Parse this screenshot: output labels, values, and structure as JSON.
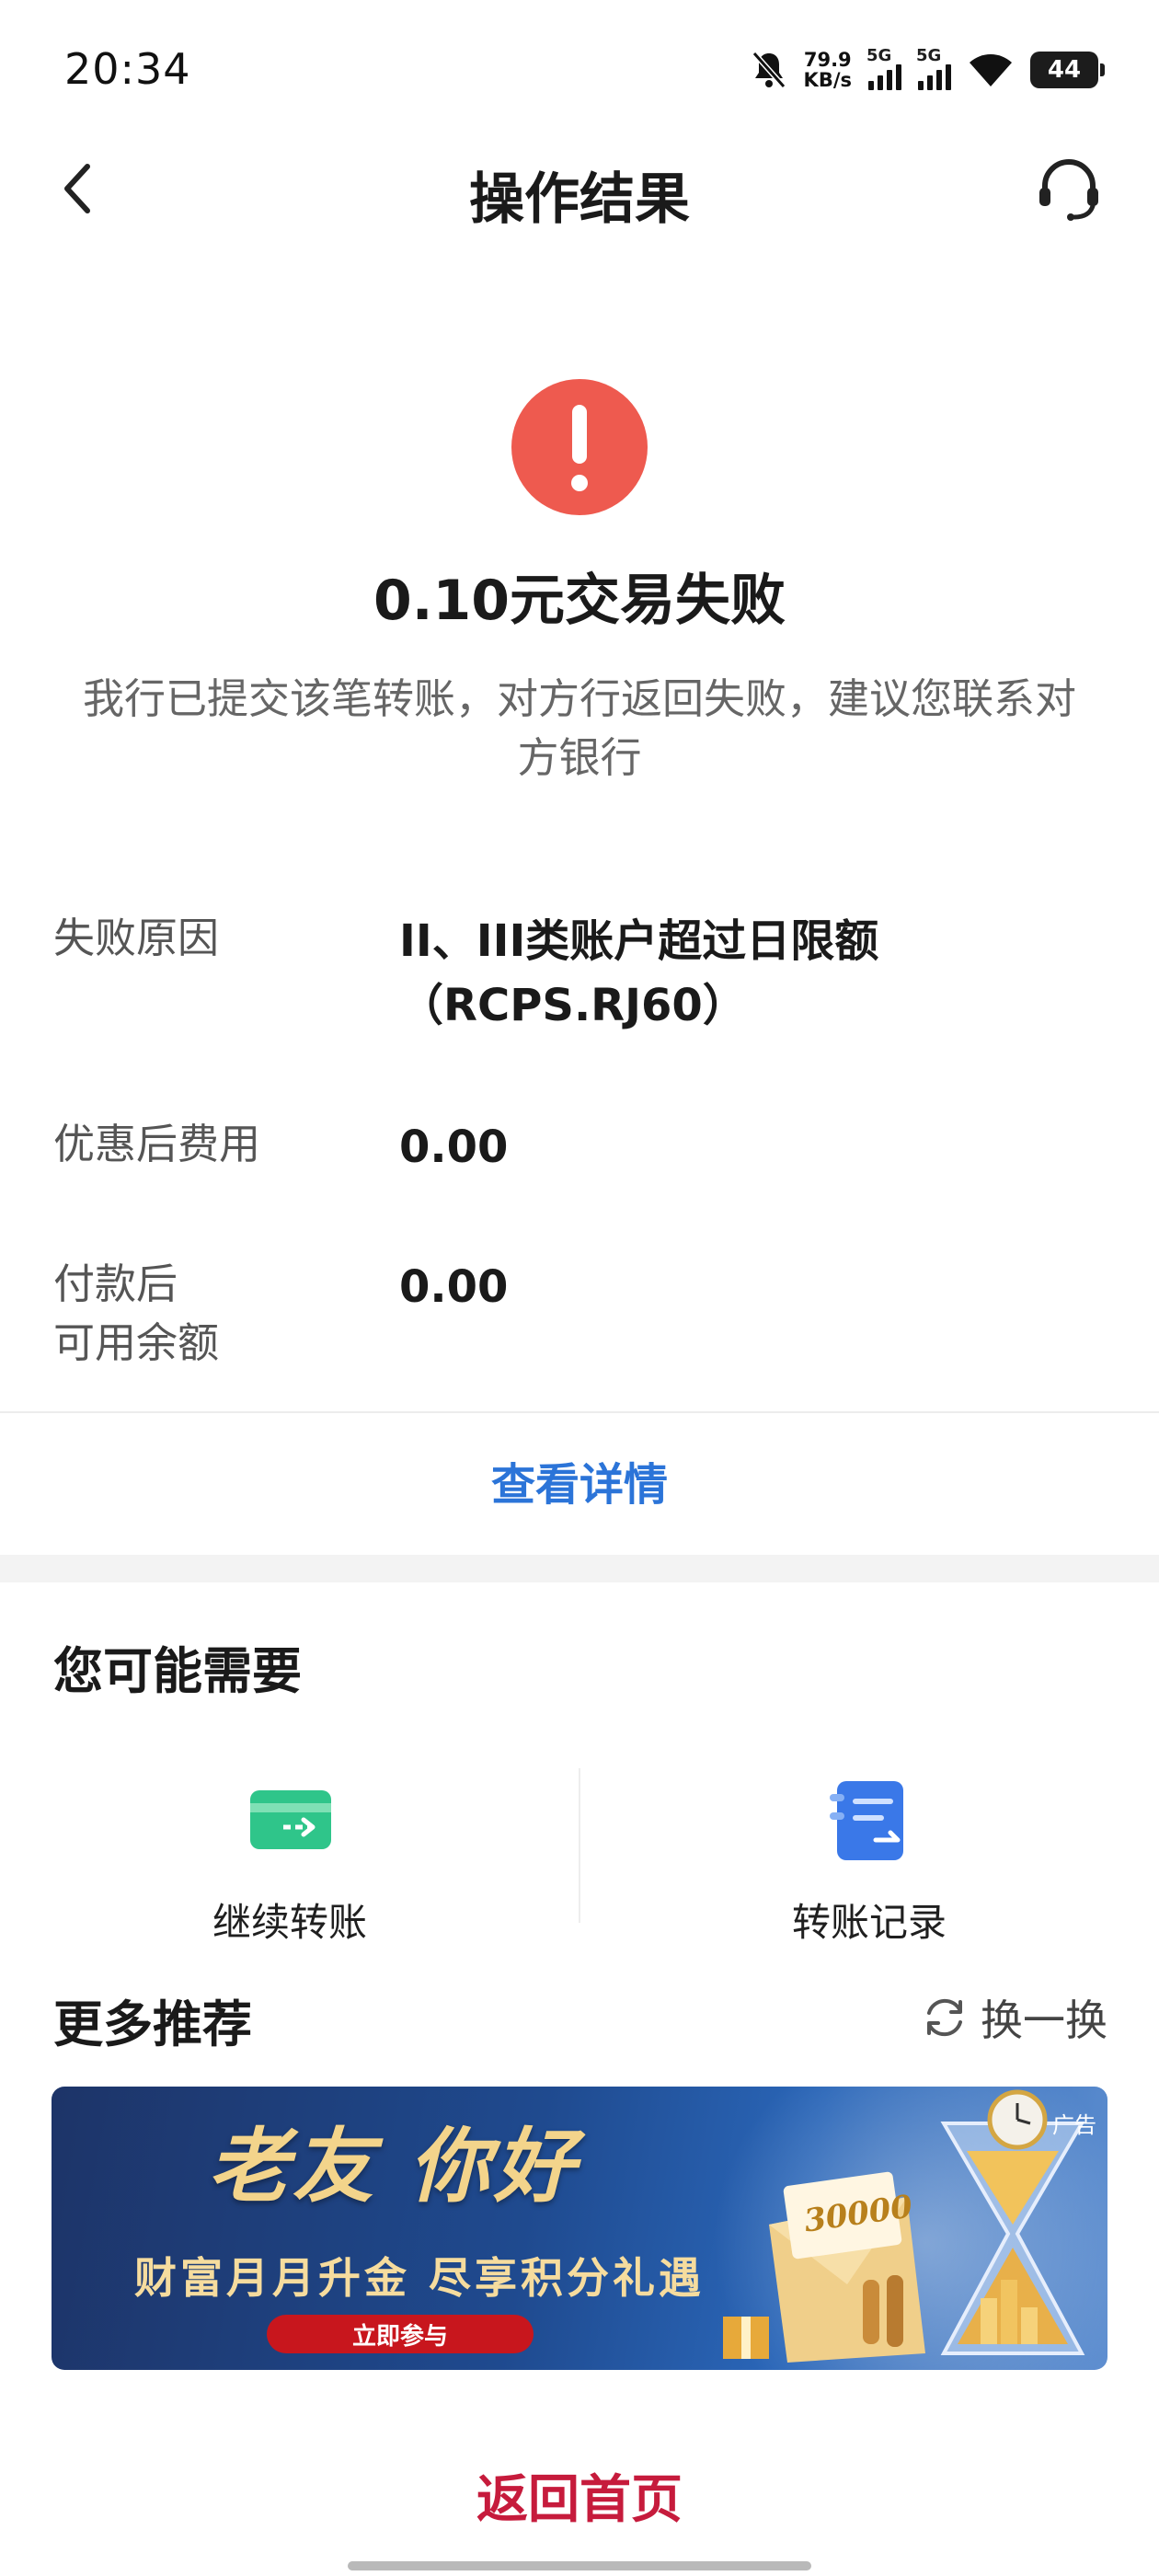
{
  "status_bar": {
    "time": "20:34",
    "net_speed_value": "79.9",
    "net_speed_unit": "KB/s",
    "signal1_label": "5G",
    "signal2_label": "5G",
    "battery": "44",
    "icons": [
      "bell-muted-icon",
      "signal-icon",
      "signal-icon",
      "wifi-icon",
      "battery-icon"
    ]
  },
  "nav": {
    "title": "操作结果"
  },
  "result": {
    "icon": "exclamation-icon",
    "icon_color": "#ee5a4f",
    "title": "0.10元交易失败",
    "description": "我行已提交该笔转账，对方行返回失败，建议您联系对方银行"
  },
  "details": {
    "rows": [
      {
        "label": "失败原因",
        "value_line1": "II、III类账户超过日限额",
        "value_line2": "（RCPS.RJ60）"
      },
      {
        "label": "优惠后费用",
        "value": "0.00"
      },
      {
        "label_line1": "付款后",
        "label_line2": "可用余额",
        "value": "0.00"
      }
    ],
    "view_details": "查看详情"
  },
  "you_may_need": {
    "title": "您可能需要",
    "items": [
      {
        "label": "继续转账",
        "icon": "card-transfer-icon"
      },
      {
        "label": "转账记录",
        "icon": "transfer-record-icon"
      }
    ]
  },
  "recommend": {
    "title": "更多推荐",
    "refresh_label": "换一换",
    "banner": {
      "ad_tag": "广告",
      "headline": "老友 你好",
      "subtitle": "财富月月升金  尽享积分礼遇",
      "cta": "立即参与",
      "gift_number": "30000"
    }
  },
  "footer": {
    "home_link": "返回首页"
  },
  "colors": {
    "accent_blue": "#2b74d8",
    "home_red": "#c61b3c",
    "error_red": "#ee5a4f"
  }
}
